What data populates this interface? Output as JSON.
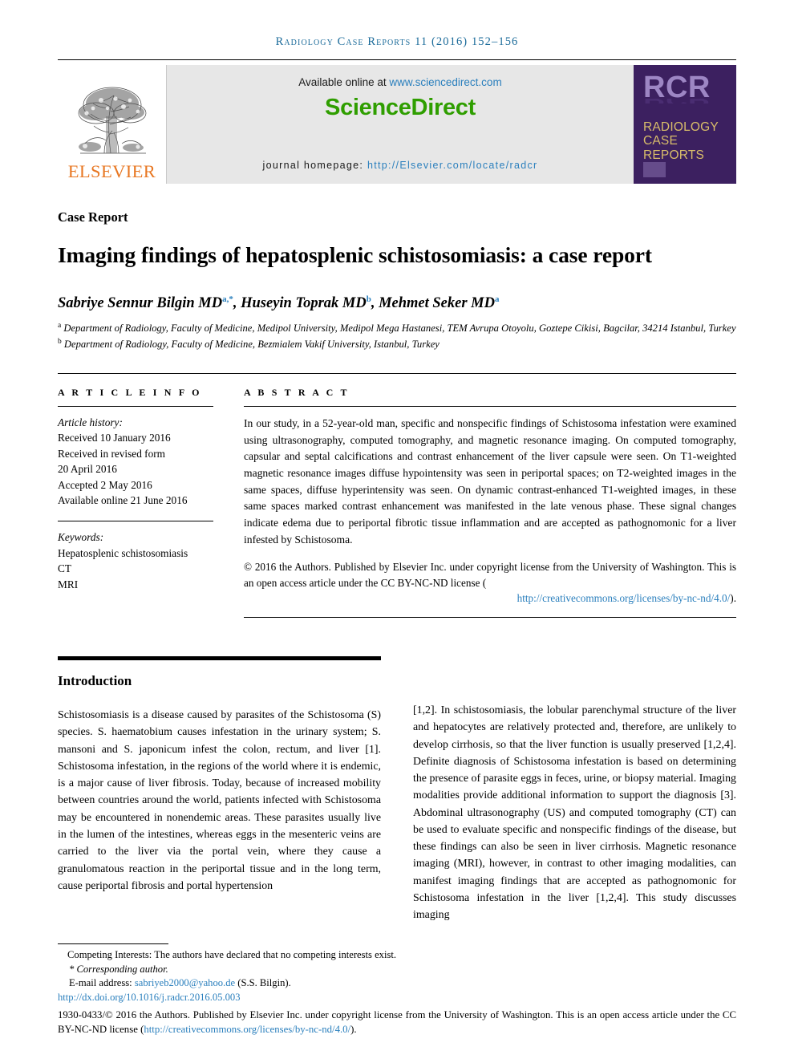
{
  "running_head": "Radiology Case Reports 11 (2016) 152–156",
  "masthead": {
    "elsevier_wordmark": "ELSEVIER",
    "available_prefix": "Available online at ",
    "available_url": "www.sciencedirect.com",
    "sciencedirect_logo": "ScienceDirect",
    "homepage_prefix": "journal homepage: ",
    "homepage_url": "http://Elsevier.com/locate/radcr",
    "rcr": {
      "acronym": "RCR",
      "line1": "RADIOLOGY",
      "line2": "CASE",
      "line3": "REPORTS"
    },
    "colors": {
      "sciencedirect_green": "#2f9e00",
      "link_blue": "#2a7fbd",
      "elsevier_orange": "#e87722",
      "rcr_purple": "#3c2060",
      "rcr_gold": "#d9bd6a",
      "banner_gray": "#e7e7e7"
    }
  },
  "article": {
    "kicker": "Case Report",
    "title": "Imaging findings of hepatosplenic schistosomiasis: a case report",
    "authors_html": "Sabriye Sennur Bilgin MD, Huseyin Toprak MD, Mehmet Seker MD",
    "author_list": [
      {
        "name": "Sabriye Sennur Bilgin MD",
        "marks": "a,*"
      },
      {
        "name": "Huseyin Toprak MD",
        "marks": "b"
      },
      {
        "name": "Mehmet Seker MD",
        "marks": "a"
      }
    ],
    "affiliations": [
      {
        "mark": "a",
        "text": "Department of Radiology, Faculty of Medicine, Medipol University, Medipol Mega Hastanesi, TEM Avrupa Otoyolu, Goztepe Cikisi, Bagcilar, 34214 Istanbul, Turkey"
      },
      {
        "mark": "b",
        "text": "Department of Radiology, Faculty of Medicine, Bezmialem Vakif University, Istanbul, Turkey"
      }
    ]
  },
  "article_info": {
    "label": "A R T I C L E  I N F O",
    "history_label": "Article history:",
    "history": [
      "Received 10 January 2016",
      "Received in revised form",
      "20 April 2016",
      "Accepted 2 May 2016",
      "Available online 21 June 2016"
    ],
    "keywords_label": "Keywords:",
    "keywords": [
      "Hepatosplenic schistosomiasis",
      "CT",
      "MRI"
    ]
  },
  "abstract": {
    "label": "A B S T R A C T",
    "body": "In our study, in a 52-year-old man, specific and nonspecific findings of Schistosoma infestation were examined using ultrasonography, computed tomography, and magnetic resonance imaging. On computed tomography, capsular and septal calcifications and contrast enhancement of the liver capsule were seen. On T1-weighted magnetic resonance images diffuse hypointensity was seen in periportal spaces; on T2-weighted images in the same spaces, diffuse hyperintensity was seen. On dynamic contrast-enhanced T1-weighted images, in these same spaces marked contrast enhancement was manifested in the late venous phase. These signal changes indicate edema due to periportal fibrotic tissue inflammation and are accepted as pathognomonic for a liver infested by Schistosoma.",
    "copyright_text": "© 2016 the Authors. Published by Elsevier Inc. under copyright license from the University of Washington. This is an open access article under the CC BY-NC-ND license (",
    "copyright_link": "http://creativecommons.org/licenses/by-nc-nd/4.0/",
    "copyright_close": ")."
  },
  "introduction": {
    "heading": "Introduction",
    "left_column": "Schistosomiasis is a disease caused by parasites of the Schistosoma (S) species. S. haematobium causes infestation in the urinary system; S. mansoni and S. japonicum infest the colon, rectum, and liver [1]. Schistosoma infestation, in the regions of the world where it is endemic, is a major cause of liver fibrosis. Today, because of increased mobility between countries around the world, patients infected with Schistosoma may be encountered in nonendemic areas. These parasites usually live in the lumen of the intestines, whereas eggs in the mesenteric veins are carried to the liver via the portal vein, where they cause a granulomatous reaction in the periportal tissue and in the long term, cause periportal fibrosis and portal hypertension",
    "right_column": "[1,2]. In schistosomiasis, the lobular parenchymal structure of the liver and hepatocytes are relatively protected and, therefore, are unlikely to develop cirrhosis, so that the liver function is usually preserved [1,2,4]. Definite diagnosis of Schistosoma infestation is based on determining the presence of parasite eggs in feces, urine, or biopsy material. Imaging modalities provide additional information to support the diagnosis [3]. Abdominal ultrasonography (US) and computed tomography (CT) can be used to evaluate specific and nonspecific findings of the disease, but these findings can also be seen in liver cirrhosis. Magnetic resonance imaging (MRI), however, in contrast to other imaging modalities, can manifest imaging findings that are accepted as pathognomonic for Schistosoma infestation in the liver [1,2,4]. This study discusses imaging"
  },
  "footnotes": {
    "competing": "Competing Interests: The authors have declared that no competing interests exist.",
    "corresponding": "* Corresponding author.",
    "email_label": "E-mail address: ",
    "email": "sabriyeb2000@yahoo.de",
    "email_suffix": " (S.S. Bilgin).",
    "doi": "http://dx.doi.org/10.1016/j.radcr.2016.05.003",
    "issn_copy_pre": "1930-0433/© 2016 the Authors. Published by Elsevier Inc. under copyright license from the University of Washington. This is an open access article under the CC BY-NC-ND license (",
    "issn_copy_link": "http://creativecommons.org/licenses/by-nc-nd/4.0/",
    "issn_copy_post": ")."
  }
}
